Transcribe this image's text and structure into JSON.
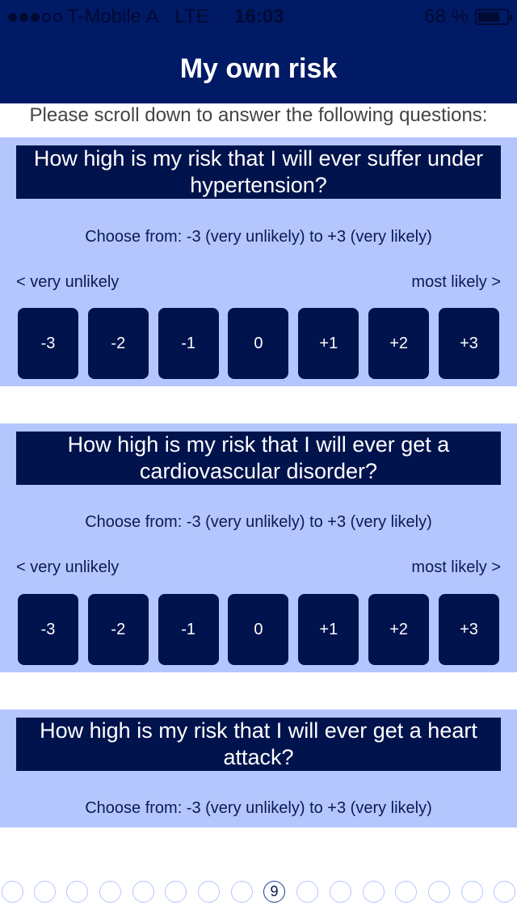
{
  "status": {
    "carrier": "T-Mobile A",
    "network": "LTE",
    "time": "16:03",
    "battery": "68 %"
  },
  "nav": {
    "title": "My own risk"
  },
  "intro": "Please scroll down to answer the following questions:",
  "scale": {
    "hint": "Choose from: -3 (very unlikely) to +3 (very likely)",
    "left": "< very unlikely",
    "right": "most likely >",
    "options": [
      "-3",
      "-2",
      "-1",
      "0",
      "+1",
      "+2",
      "+3"
    ]
  },
  "questions": [
    "How high is my risk that I will ever suffer under hypertension?",
    "How high is my risk that I will ever get a cardiovascular disorder?",
    "How high is my risk that I will ever get a heart attack?"
  ],
  "pager": {
    "current": "9"
  }
}
